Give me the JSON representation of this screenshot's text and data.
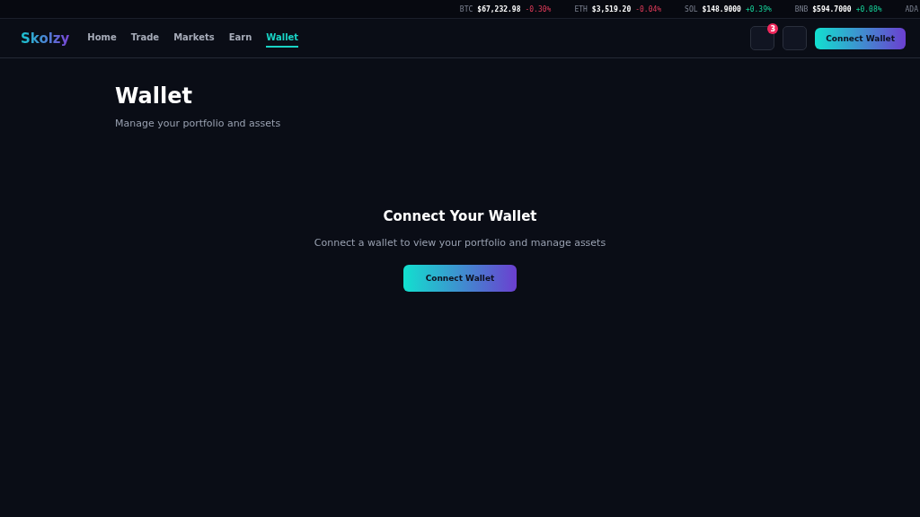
{
  "ticker": [
    {
      "symbol": "BTC",
      "price": "$67,232.98",
      "change": "-0.30%",
      "kind": "down"
    },
    {
      "symbol": "ETH",
      "price": "$3,519.20",
      "change": "-0.04%",
      "kind": "down"
    },
    {
      "symbol": "SOL",
      "price": "$148.9000",
      "change": "+0.39%",
      "kind": "up"
    },
    {
      "symbol": "BNB",
      "price": "$594.7000",
      "change": "+0.08%",
      "kind": "up"
    },
    {
      "symbol": "ADA"
    }
  ],
  "nav": {
    "logo": "Skolzy",
    "links": [
      {
        "label": "Home",
        "selected": false
      },
      {
        "label": "Trade",
        "selected": false
      },
      {
        "label": "Markets",
        "selected": false
      },
      {
        "label": "Earn",
        "selected": false
      },
      {
        "label": "Wallet",
        "selected": true
      }
    ],
    "notification_badge": "3",
    "connect_button": "Connect Wallet"
  },
  "page": {
    "title": "Wallet",
    "subtitle": "Manage your portfolio and assets"
  },
  "empty_state": {
    "title": "Connect Your Wallet",
    "text": "Connect a wallet to view your portfolio and manage assets",
    "button": "Connect Wallet"
  }
}
